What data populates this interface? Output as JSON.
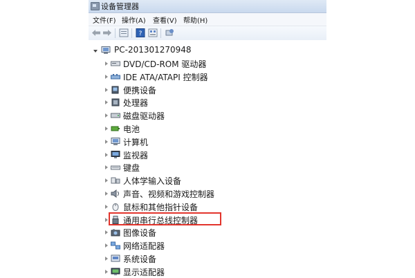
{
  "window": {
    "title": "设备管理器"
  },
  "menu": {
    "items": [
      "文件(F)",
      "操作(A)",
      "查看(V)",
      "帮助(H)"
    ]
  },
  "toolbar": {
    "icons": [
      "back-arrow-icon",
      "forward-arrow-icon",
      "properties-icon",
      "help-icon",
      "view-icon",
      "scan-hardware-icon"
    ]
  },
  "tree": {
    "root": {
      "label": "PC-201301270948",
      "icon": "computer-icon",
      "expanded": true
    },
    "items": [
      {
        "label": "DVD/CD-ROM 驱动器",
        "icon": "dvd-drive-icon"
      },
      {
        "label": "IDE ATA/ATAPI 控制器",
        "icon": "ide-controller-icon"
      },
      {
        "label": "便携设备",
        "icon": "portable-device-icon"
      },
      {
        "label": "处理器",
        "icon": "processor-icon"
      },
      {
        "label": "磁盘驱动器",
        "icon": "disk-drive-icon"
      },
      {
        "label": "电池",
        "icon": "battery-icon"
      },
      {
        "label": "计算机",
        "icon": "computer-icon"
      },
      {
        "label": "监视器",
        "icon": "monitor-icon"
      },
      {
        "label": "键盘",
        "icon": "keyboard-icon"
      },
      {
        "label": "人体学输入设备",
        "icon": "hid-icon"
      },
      {
        "label": "声音、视频和游戏控制器",
        "icon": "sound-icon"
      },
      {
        "label": "鼠标和其他指针设备",
        "icon": "mouse-icon"
      },
      {
        "label": "通用串行总线控制器",
        "icon": "usb-icon",
        "highlighted": true
      },
      {
        "label": "图像设备",
        "icon": "imaging-device-icon"
      },
      {
        "label": "网络适配器",
        "icon": "network-adapter-icon"
      },
      {
        "label": "系统设备",
        "icon": "system-device-icon"
      },
      {
        "label": "显示适配器",
        "icon": "display-adapter-icon"
      }
    ]
  },
  "colors": {
    "highlight_border": "#e2342c",
    "titlebar": "#c9d9ee"
  }
}
